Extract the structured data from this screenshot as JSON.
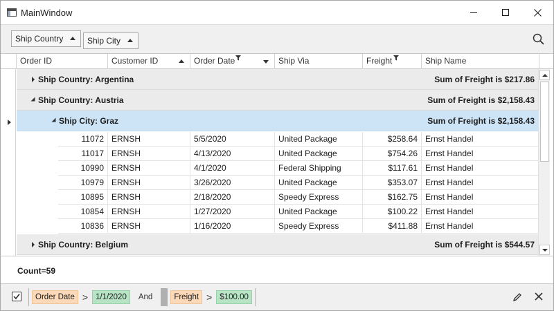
{
  "window": {
    "title": "MainWindow"
  },
  "group_panel": {
    "chips": [
      {
        "label": "Ship Country",
        "sort": "ascending"
      },
      {
        "label": "Ship City",
        "sort": "ascending"
      }
    ]
  },
  "columns": [
    {
      "label": "Order ID"
    },
    {
      "label": "Customer ID",
      "sort": "ascending"
    },
    {
      "label": "Order Date",
      "sort": "descending",
      "filtered": true
    },
    {
      "label": "Ship Via"
    },
    {
      "label": "Freight",
      "filtered": true
    },
    {
      "label": "Ship Name"
    }
  ],
  "groups": {
    "argentina": {
      "caption": "Ship Country: Argentina",
      "summary": "Sum of Freight is $217.86",
      "expanded": false
    },
    "austria": {
      "caption": "Ship Country: Austria",
      "summary": "Sum of Freight is $2,158.43",
      "expanded": true
    },
    "graz": {
      "caption": "Ship City: Graz",
      "summary": "Sum of Freight is $2,158.43",
      "expanded": true,
      "selected": true
    },
    "belgium": {
      "caption": "Ship Country: Belgium",
      "summary": "Sum of Freight is $544.57",
      "expanded": false
    }
  },
  "rows": [
    {
      "order_id": "11072",
      "customer_id": "ERNSH",
      "order_date": "5/5/2020",
      "ship_via": "United Package",
      "freight": "$258.64",
      "ship_name": "Ernst Handel"
    },
    {
      "order_id": "11017",
      "customer_id": "ERNSH",
      "order_date": "4/13/2020",
      "ship_via": "United Package",
      "freight": "$754.26",
      "ship_name": "Ernst Handel"
    },
    {
      "order_id": "10990",
      "customer_id": "ERNSH",
      "order_date": "4/1/2020",
      "ship_via": "Federal Shipping",
      "freight": "$117.61",
      "ship_name": "Ernst Handel"
    },
    {
      "order_id": "10979",
      "customer_id": "ERNSH",
      "order_date": "3/26/2020",
      "ship_via": "United Package",
      "freight": "$353.07",
      "ship_name": "Ernst Handel"
    },
    {
      "order_id": "10895",
      "customer_id": "ERNSH",
      "order_date": "2/18/2020",
      "ship_via": "Speedy Express",
      "freight": "$162.75",
      "ship_name": "Ernst Handel"
    },
    {
      "order_id": "10854",
      "customer_id": "ERNSH",
      "order_date": "1/27/2020",
      "ship_via": "United Package",
      "freight": "$100.22",
      "ship_name": "Ernst Handel"
    },
    {
      "order_id": "10836",
      "customer_id": "ERNSH",
      "order_date": "1/16/2020",
      "ship_via": "Speedy Express",
      "freight": "$411.88",
      "ship_name": "Ernst Handel"
    }
  ],
  "summary": {
    "text": "Count=59"
  },
  "filter": {
    "enabled": true,
    "field1": "Order Date",
    "op1": ">",
    "value1": "1/1/2020",
    "logic": "And",
    "field2": "Freight",
    "op2": ">",
    "value2": "$100.00"
  },
  "icons": {
    "app": "window-icon",
    "minimize": "minimize-icon",
    "maximize": "maximize-icon",
    "close": "close-icon",
    "search": "search-icon",
    "edit": "pencil-icon",
    "clear": "close-icon"
  },
  "colors": {
    "group_row_bg": "#ebebeb",
    "selected_row_bg": "#cde4f7",
    "filter_field_bg": "#fcd9b8",
    "filter_value_bg": "#b8e4c6",
    "panel_bg": "#f0f0f0"
  }
}
